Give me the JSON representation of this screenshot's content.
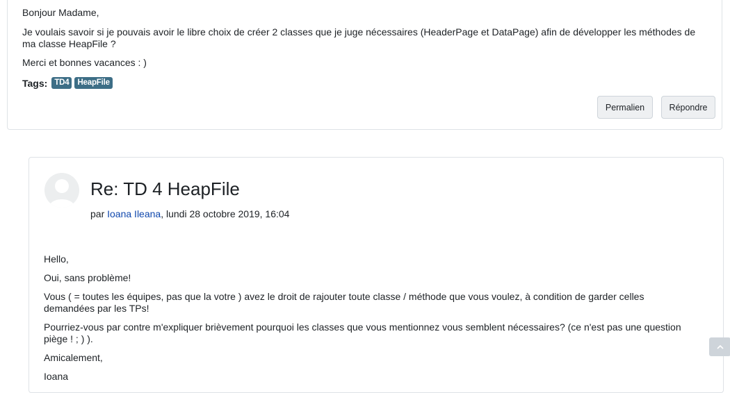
{
  "post1": {
    "greeting": "Bonjour Madame,",
    "question": "Je voulais savoir si je pouvais avoir le libre choix de créer 2 classes que je juge nécessaires (HeaderPage et DataPage) afin de développer les méthodes de ma classe HeapFile ?",
    "thanks": "Merci et bonnes vacances : )",
    "tags_label": "Tags:",
    "tags": [
      "TD4",
      "HeapFile"
    ],
    "permalink_label": "Permalien",
    "reply_label": "Répondre"
  },
  "post2": {
    "title": "Re: TD 4 HeapFile",
    "by_prefix": "par ",
    "author": "Ioana Ileana",
    "date": ", lundi 28 octobre 2019, 16:04",
    "lines": [
      "Hello,",
      "Oui, sans problème!",
      "Vous ( =  toutes les équipes, pas que la votre ) avez le droit de rajouter toute classe / méthode que vous voulez, à condition de garder celles demandées par les TPs!",
      "Pourriez-vous par contre m'expliquer brièvement pourquoi les classes que vous mentionnez vous semblent nécessaires? (ce n'est pas une question piège ! ; ) ).",
      "Amicalement,",
      "Ioana"
    ]
  },
  "icons": {
    "avatar": "user-avatar-icon",
    "scroll_top": "chevron-up-icon"
  }
}
